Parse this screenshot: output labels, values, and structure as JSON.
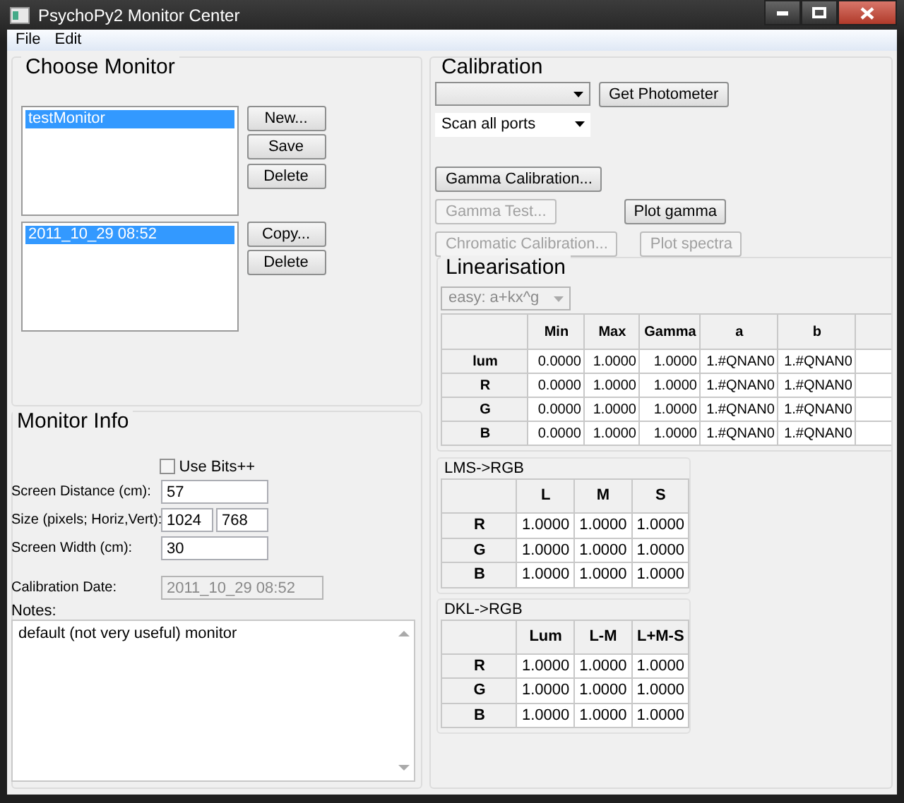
{
  "window": {
    "title": "PsychoPy2 Monitor Center"
  },
  "menu": [
    "File",
    "Edit"
  ],
  "choose_monitor": {
    "title": "Choose Monitor",
    "monitors": [
      {
        "label": "testMonitor",
        "selected": true
      }
    ],
    "monitor_buttons": [
      "New...",
      "Save",
      "Delete"
    ],
    "calibrations": [
      {
        "label": "2011_10_29 08:52",
        "selected": true
      }
    ],
    "calibration_buttons": [
      "Copy...",
      "Delete"
    ]
  },
  "monitor_info": {
    "title": "Monitor Info",
    "use_bits": {
      "label": "Use Bits++",
      "checked": false
    },
    "fields": [
      {
        "label": "Screen Distance (cm):",
        "values": [
          "57"
        ],
        "disabled": false
      },
      {
        "label": "Size (pixels; Horiz,Vert):",
        "values": [
          "1024",
          "768"
        ],
        "disabled": false
      },
      {
        "label": "Screen Width (cm):",
        "values": [
          "30"
        ],
        "disabled": false
      },
      {
        "label": "Calibration Date:",
        "values": [
          "2011_10_29 08:52"
        ],
        "disabled": true
      }
    ],
    "notes_label": "Notes:",
    "notes": "default (not very useful) monitor"
  },
  "calibration": {
    "title": "Calibration",
    "port_select": {
      "value": "Scan all ports"
    },
    "get_photometer": "Get Photometer",
    "button_rows": [
      [
        {
          "label": "Gamma Calibration...",
          "disabled": false
        }
      ],
      [
        {
          "label": "Gamma Test...",
          "disabled": true
        },
        {
          "label": "Plot gamma",
          "disabled": false
        }
      ],
      [
        {
          "label": "Chromatic Calibration...",
          "disabled": true
        },
        {
          "label": "Plot spectra",
          "disabled": true
        }
      ]
    ]
  },
  "linearisation": {
    "title": "Linearisation",
    "method": {
      "value": "easy: a+kx^g",
      "disabled": true
    },
    "columns": [
      "Min",
      "Max",
      "Gamma",
      "a",
      "b"
    ],
    "rows": [
      {
        "label": "lum",
        "cells": [
          "0.0000",
          "1.0000",
          "1.0000",
          "1.#QNAN0",
          "1.#QNAN0"
        ]
      },
      {
        "label": "R",
        "cells": [
          "0.0000",
          "1.0000",
          "1.0000",
          "1.#QNAN0",
          "1.#QNAN0"
        ]
      },
      {
        "label": "G",
        "cells": [
          "0.0000",
          "1.0000",
          "1.0000",
          "1.#QNAN0",
          "1.#QNAN0"
        ]
      },
      {
        "label": "B",
        "cells": [
          "0.0000",
          "1.0000",
          "1.0000",
          "1.#QNAN0",
          "1.#QNAN0"
        ]
      }
    ]
  },
  "lms_to_rgb": {
    "title": "LMS->RGB",
    "columns": [
      "L",
      "M",
      "S"
    ],
    "rows": [
      {
        "label": "R",
        "cells": [
          "1.0000",
          "1.0000",
          "1.0000"
        ]
      },
      {
        "label": "G",
        "cells": [
          "1.0000",
          "1.0000",
          "1.0000"
        ]
      },
      {
        "label": "B",
        "cells": [
          "1.0000",
          "1.0000",
          "1.0000"
        ]
      }
    ]
  },
  "dkl_to_rgb": {
    "title": "DKL->RGB",
    "columns": [
      "Lum",
      "L-M",
      "L+M-S"
    ],
    "rows": [
      {
        "label": "R",
        "cells": [
          "1.0000",
          "1.0000",
          "1.0000"
        ]
      },
      {
        "label": "G",
        "cells": [
          "1.0000",
          "1.0000",
          "1.0000"
        ]
      },
      {
        "label": "B",
        "cells": [
          "1.0000",
          "1.0000",
          "1.0000"
        ]
      }
    ]
  }
}
